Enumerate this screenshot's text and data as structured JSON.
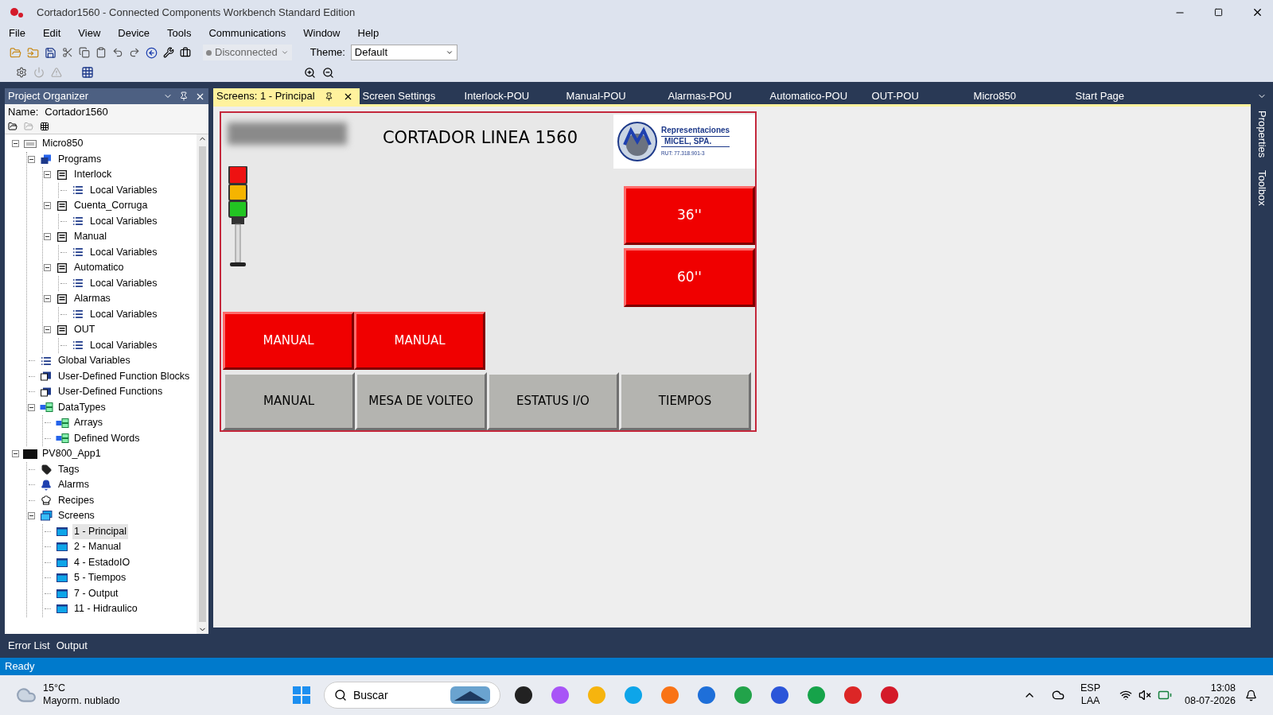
{
  "window": {
    "title": "Cortador1560 - Connected Components Workbench Standard Edition"
  },
  "menu": [
    "File",
    "Edit",
    "View",
    "Device",
    "Tools",
    "Communications",
    "Window",
    "Help"
  ],
  "toolbar": {
    "connection": "Disconnected",
    "theme_label": "Theme:",
    "theme_value": "Default"
  },
  "project_organizer": {
    "title": "Project Organizer",
    "name_label": "Name:",
    "name_value": "Cortador1560",
    "tree": [
      {
        "label": "Micro850",
        "kind": "controller",
        "expanded": true,
        "selected": false,
        "children": [
          {
            "label": "Programs",
            "kind": "programs",
            "expanded": true,
            "selected": false,
            "children": [
              {
                "label": "Interlock",
                "kind": "program",
                "expanded": true,
                "selected": false,
                "children": [
                  {
                    "label": "Local Variables",
                    "kind": "variables",
                    "selected": false
                  }
                ]
              },
              {
                "label": "Cuenta_Corruga",
                "kind": "program",
                "expanded": true,
                "selected": false,
                "children": [
                  {
                    "label": "Local Variables",
                    "kind": "variables",
                    "selected": false
                  }
                ]
              },
              {
                "label": "Manual",
                "kind": "program",
                "expanded": true,
                "selected": false,
                "children": [
                  {
                    "label": "Local Variables",
                    "kind": "variables",
                    "selected": false
                  }
                ]
              },
              {
                "label": "Automatico",
                "kind": "program",
                "expanded": true,
                "selected": false,
                "children": [
                  {
                    "label": "Local Variables",
                    "kind": "variables",
                    "selected": false
                  }
                ]
              },
              {
                "label": "Alarmas",
                "kind": "program",
                "expanded": true,
                "selected": false,
                "children": [
                  {
                    "label": "Local Variables",
                    "kind": "variables",
                    "selected": false
                  }
                ]
              },
              {
                "label": "OUT",
                "kind": "program",
                "expanded": true,
                "selected": false,
                "children": [
                  {
                    "label": "Local Variables",
                    "kind": "variables",
                    "selected": false
                  }
                ]
              }
            ]
          },
          {
            "label": "Global Variables",
            "kind": "variables",
            "selected": false
          },
          {
            "label": "User-Defined Function Blocks",
            "kind": "function",
            "selected": false
          },
          {
            "label": "User-Defined Functions",
            "kind": "function",
            "selected": false
          },
          {
            "label": "DataTypes",
            "kind": "datatype",
            "expanded": true,
            "selected": false,
            "children": [
              {
                "label": "Arrays",
                "kind": "datatype",
                "selected": false
              },
              {
                "label": "Defined Words",
                "kind": "datatype",
                "selected": false
              }
            ]
          }
        ]
      },
      {
        "label": "PV800_App1",
        "kind": "panel",
        "expanded": true,
        "selected": false,
        "children": [
          {
            "label": "Tags",
            "kind": "tag",
            "selected": false
          },
          {
            "label": "Alarms",
            "kind": "alarm",
            "selected": false
          },
          {
            "label": "Recipes",
            "kind": "recipe",
            "selected": false
          },
          {
            "label": "Screens",
            "kind": "screens",
            "expanded": true,
            "selected": false,
            "children": [
              {
                "label": "1 - Principal",
                "kind": "screen",
                "selected": true
              },
              {
                "label": "2 - Manual",
                "kind": "screen",
                "selected": false
              },
              {
                "label": "4 - EstadoIO",
                "kind": "screen",
                "selected": false
              },
              {
                "label": "5 - Tiempos",
                "kind": "screen",
                "selected": false
              },
              {
                "label": "7 - Output",
                "kind": "screen",
                "selected": false
              },
              {
                "label": "11 - Hidraulico",
                "kind": "screen",
                "selected": false
              }
            ]
          }
        ]
      }
    ]
  },
  "tabs": [
    {
      "label": "Screens: 1 - Principal",
      "selected": true
    },
    {
      "label": "Screen Settings",
      "selected": false
    },
    {
      "label": "Interlock-POU",
      "selected": false
    },
    {
      "label": "Manual-POU",
      "selected": false
    },
    {
      "label": "Alarmas-POU",
      "selected": false
    },
    {
      "label": "Automatico-POU",
      "selected": false
    },
    {
      "label": "OUT-POU",
      "selected": false
    },
    {
      "label": "Micro850",
      "selected": false
    },
    {
      "label": "Start Page",
      "selected": false
    }
  ],
  "hmi_screen": {
    "title": "CORTADOR LINEA 1560",
    "logo": {
      "line1": "Representaciones",
      "line2": "MICEL, SPA.",
      "rut": "RUT: 77.318.901-3"
    },
    "size_buttons": [
      {
        "label": "36''",
        "kind": "red"
      },
      {
        "label": "60''",
        "kind": "red"
      }
    ],
    "mode_buttons": [
      {
        "label": "MANUAL",
        "kind": "red"
      },
      {
        "label": "MANUAL",
        "kind": "red"
      }
    ],
    "nav_buttons": [
      {
        "label": "MANUAL",
        "kind": "gray"
      },
      {
        "label": "MESA DE VOLTEO",
        "kind": "gray"
      },
      {
        "label": "ESTATUS I/O",
        "kind": "gray"
      },
      {
        "label": "TIEMPOS",
        "kind": "gray"
      }
    ]
  },
  "side_panels": [
    "Properties",
    "Toolbox"
  ],
  "bottom_tabs": [
    "Error List",
    "Output"
  ],
  "status_bar": "Ready",
  "taskbar": {
    "temperature": "15°C",
    "weather": "Mayorm. nublado",
    "search": "Buscar",
    "language": "ESP",
    "layout": "LAA",
    "time": "13:08",
    "date": "08-07-2026"
  }
}
